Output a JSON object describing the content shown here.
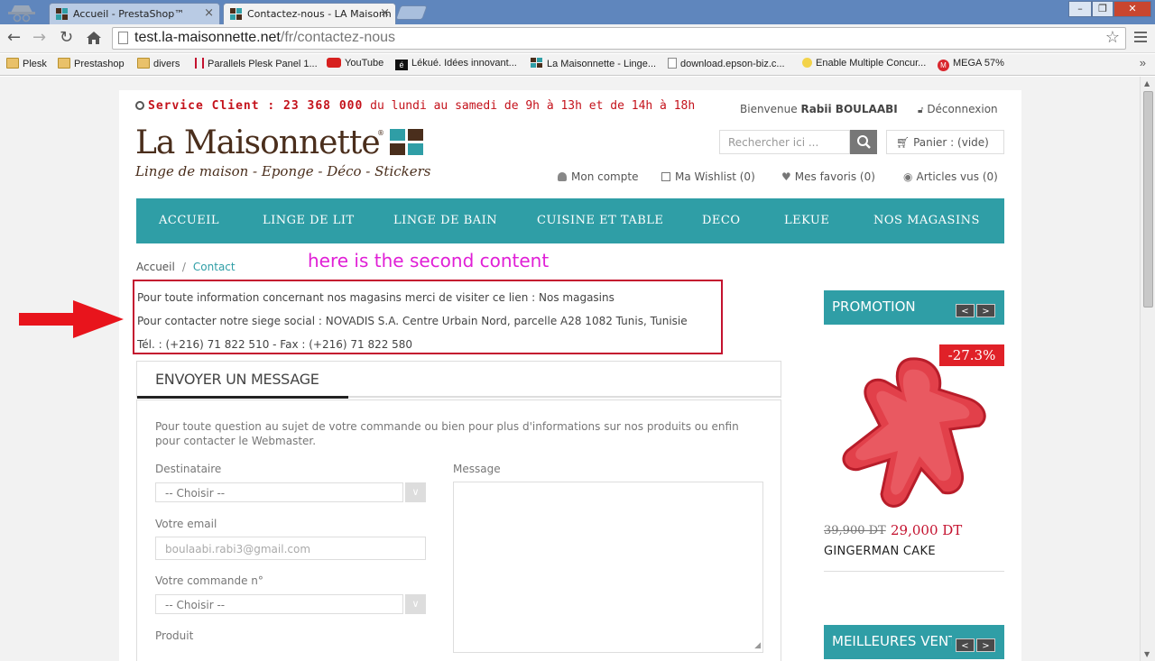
{
  "browser": {
    "tabs": [
      {
        "title": "Accueil - PrestaShop™",
        "active": false
      },
      {
        "title": "Contactez-nous - LA Maisonn",
        "active": true
      }
    ],
    "url_host": "test.la-maisonnette.net",
    "url_path": "/fr/contactez-nous",
    "bookmarks": [
      {
        "label": "Plesk",
        "icon": "folder-icon"
      },
      {
        "label": "Prestashop",
        "icon": "folder-icon"
      },
      {
        "label": "divers",
        "icon": "folder-icon"
      },
      {
        "label": "Parallels Plesk Panel 1...",
        "icon": "parallels-icon"
      },
      {
        "label": "YouTube",
        "icon": "youtube-icon"
      },
      {
        "label": "Lékué. Idées innovant...",
        "icon": "lekue-icon"
      },
      {
        "label": "La Maisonnette - Linge...",
        "icon": "maisonnette-icon"
      },
      {
        "label": "download.epson-biz.c...",
        "icon": "page-icon"
      },
      {
        "label": "Enable Multiple Concur...",
        "icon": "bulb-icon"
      },
      {
        "label": "MEGA 57%",
        "icon": "mega-icon"
      }
    ]
  },
  "header": {
    "service_label": "Service Client : 23 368 000",
    "service_hours": "du lundi au samedi de 9h à 13h et de 14h à 18h",
    "logo_title": "La Maisonnette",
    "logo_mark": "®",
    "logo_tagline": "Linge de maison - Eponge - Déco - Stickers",
    "welcome_prefix": "Bienvenue",
    "user_name": "Rabii BOULAABI",
    "logout": "Déconnexion",
    "search_placeholder": "Rechercher ici ...",
    "cart": "Panier : (vide)",
    "user_links": {
      "account": "Mon compte",
      "wishlist": "Ma Wishlist (0)",
      "favorites": "Mes favoris (0)",
      "viewed": "Articles vus (0)"
    },
    "colors": {
      "brand_teal": "#2f9ea6",
      "service_red": "#c4121b",
      "logo_brown": "#4a2e1c"
    }
  },
  "nav": [
    "ACCUEIL",
    "LINGE DE LIT",
    "LINGE DE BAIN",
    "CUISINE ET TABLE",
    "DECO",
    "LEKUE",
    "NOS MAGASINS"
  ],
  "breadcrumb": {
    "home": "Accueil",
    "sep": "/",
    "current": "Contact"
  },
  "annotation": "here is the second content",
  "info": {
    "line1": "Pour toute information concernant nos magasins merci de visiter ce lien : Nos magasins",
    "line2": "Pour contacter notre siege social : NOVADIS S.A. Centre Urbain Nord, parcelle A28 1082 Tunis, Tunisie",
    "line3": "Tél. : (+216) 71 822 510 - Fax : (+216) 71 822 580"
  },
  "form": {
    "title": "ENVOYER UN MESSAGE",
    "intro": "Pour toute question au sujet de votre commande ou bien pour plus d'informations sur nos produits ou enfin pour contacter le Webmaster.",
    "recipient_label": "Destinataire",
    "recipient_value": "-- Choisir --",
    "email_label": "Votre email",
    "email_value": "boulaabi.rabi3@gmail.com",
    "order_label": "Votre commande n°",
    "order_value": "-- Choisir --",
    "product_label": "Produit",
    "message_label": "Message",
    "select_caret": "∨"
  },
  "sidebar": {
    "promo_title": "PROMOTION",
    "best_title": "MEILLEURES VENTES",
    "prev": "<",
    "next": ">",
    "product": {
      "discount": "-27.3%",
      "old_price": "39,900 DT",
      "price": "29,000 DT",
      "name": "GINGERMAN CAKE"
    }
  }
}
